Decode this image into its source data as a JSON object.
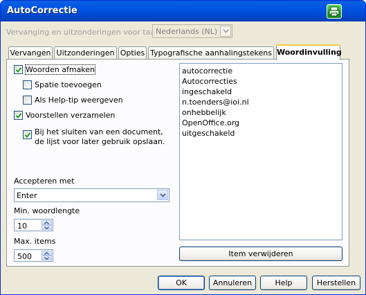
{
  "window": {
    "title": "AutoCorrectie"
  },
  "language": {
    "label": "Vervanging en uitzonderingen voor taal",
    "value": "Nederlands (NL)"
  },
  "tabs": [
    {
      "label": "Vervangen"
    },
    {
      "label": "Uitzonderingen"
    },
    {
      "label": "Opties"
    },
    {
      "label": "Typografische aanhalingstekens"
    },
    {
      "label": "Woordinvulling"
    }
  ],
  "options": {
    "complete_words": {
      "label": "Woorden afmaken",
      "checked": true
    },
    "append_space": {
      "label": "Spatie toevoegen",
      "checked": false
    },
    "show_tip": {
      "label": "Als Help-tip weergeven",
      "checked": false
    },
    "collect_words": {
      "label": "Voorstellen verzamelen",
      "checked": true
    },
    "save_list": {
      "label": "Bij het sluiten van een document, de lijst voor later gebruik opslaan.",
      "checked": true
    }
  },
  "accept_with": {
    "label": "Accepteren met",
    "value": "Enter"
  },
  "min_word_length": {
    "label": "Min. woordlengte",
    "value": "10"
  },
  "max_items": {
    "label": "Max. items",
    "value": "500"
  },
  "word_list": [
    "autocorrectie",
    "Autocorrecties",
    "ingeschakeld",
    "n.toenders@ioi.nl",
    "onhebbelijk",
    "OpenOffice.org",
    "uitgeschakeld"
  ],
  "buttons": {
    "delete_item": "Item verwijderen",
    "ok": "OK",
    "cancel": "Annuleren",
    "help": "Help",
    "reset": "Herstellen"
  },
  "colors": {
    "titlebar": "#0054e3",
    "close_button": "#1e9e1e",
    "active_tab_accent": "#ffc83c",
    "dialog_bg": "#ece9d8"
  }
}
